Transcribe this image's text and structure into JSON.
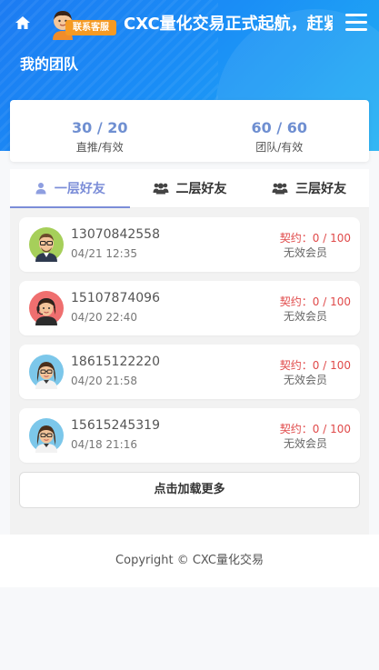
{
  "header": {
    "marquee": "CXC量化交易正式起航，赶紧加入吧",
    "customer_service": "联系客服",
    "title": "我的团队"
  },
  "stats": [
    {
      "value": "30 / 20",
      "label": "直推/有效"
    },
    {
      "value": "60 / 60",
      "label": "团队/有效"
    }
  ],
  "tabs": [
    {
      "label": "一层好友",
      "icon": "user-icon",
      "active": true
    },
    {
      "label": "二层好友",
      "icon": "users-icon",
      "active": false
    },
    {
      "label": "三层好友",
      "icon": "users-icon",
      "active": false
    }
  ],
  "members": [
    {
      "phone": "13070842558",
      "time": "04/21 12:35",
      "contract": "契约：0 / 100",
      "status": "无效会员",
      "avatar": "man-glasses-avatar"
    },
    {
      "phone": "15107874096",
      "time": "04/20 22:40",
      "contract": "契约：0 / 100",
      "status": "无效会员",
      "avatar": "woman-headset-avatar"
    },
    {
      "phone": "18615122220",
      "time": "04/20 21:58",
      "contract": "契约：0 / 100",
      "status": "无效会员",
      "avatar": "woman-glasses-avatar"
    },
    {
      "phone": "15615245319",
      "time": "04/18 21:16",
      "contract": "契约：0 / 100",
      "status": "无效会员",
      "avatar": "woman-glasses-avatar"
    }
  ],
  "load_more": "点击加载更多",
  "footer": "Copyright © CXC量化交易",
  "colors": {
    "accent": "#7b8dd8",
    "header_start": "#1c7bf2",
    "header_end": "#22b1f3",
    "contract": "#e04a4a"
  }
}
